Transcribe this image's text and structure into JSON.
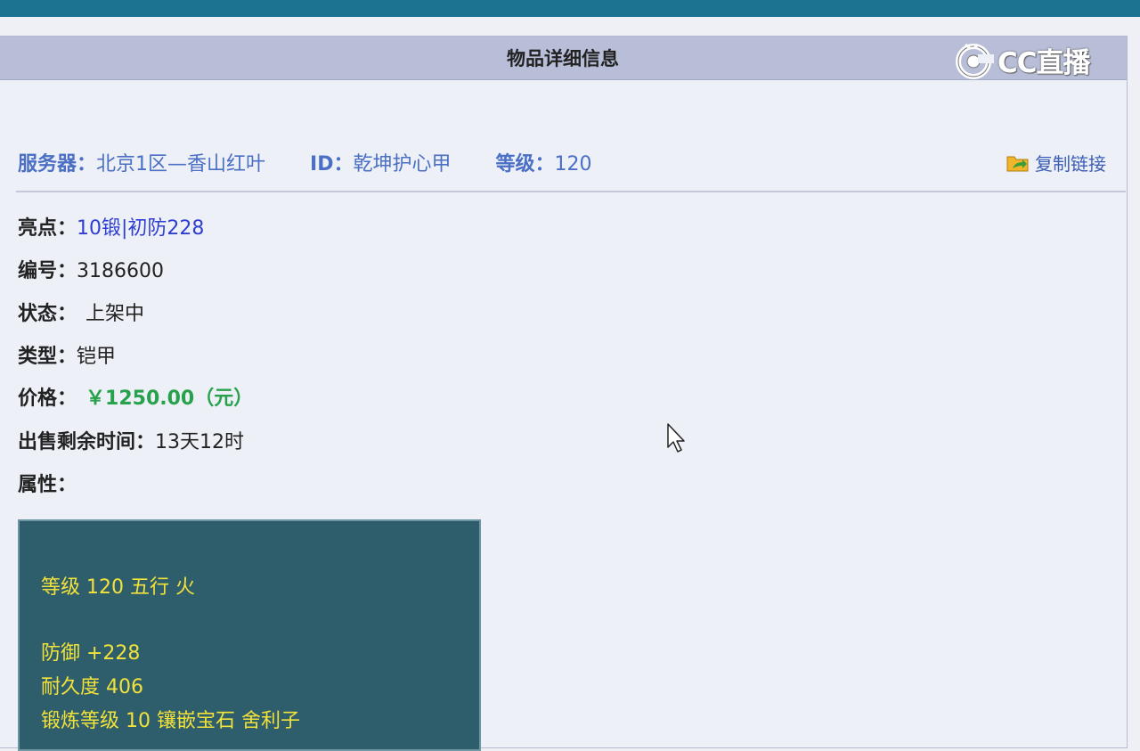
{
  "header": {
    "title": "物品详细信息"
  },
  "logo": {
    "text": "CC直播"
  },
  "info": {
    "server_label": "服务器：",
    "server_value": "北京1区—香山红叶",
    "id_label": "ID：",
    "id_value": "乾坤护心甲",
    "level_label": "等级：",
    "level_value": "120"
  },
  "copy_link": "复制链接",
  "fields": {
    "highlight_label": "亮点：",
    "highlight_value": "10锻|初防228",
    "number_label": "编号：",
    "number_value": "3186600",
    "status_label": "状态：",
    "status_value": "上架中",
    "type_label": "类型：",
    "type_value": "铠甲",
    "price_label": "价格：",
    "price_value": "￥1250.00（元）",
    "time_label": "出售剩余时间：",
    "time_value": "13天12时",
    "attr_label": "属性："
  },
  "attributes": {
    "line1": "等级 120 五行 火",
    "line2": "防御 +228",
    "line3": "耐久度 406",
    "line4": "锻炼等级 10 镶嵌宝石 舍利子"
  },
  "colors": {
    "topbar": "#1b7391",
    "header": "#b8bed8",
    "price": "#27a14b",
    "attr_bg": "#2e5d6c",
    "attr_text": "#f2e23a"
  }
}
